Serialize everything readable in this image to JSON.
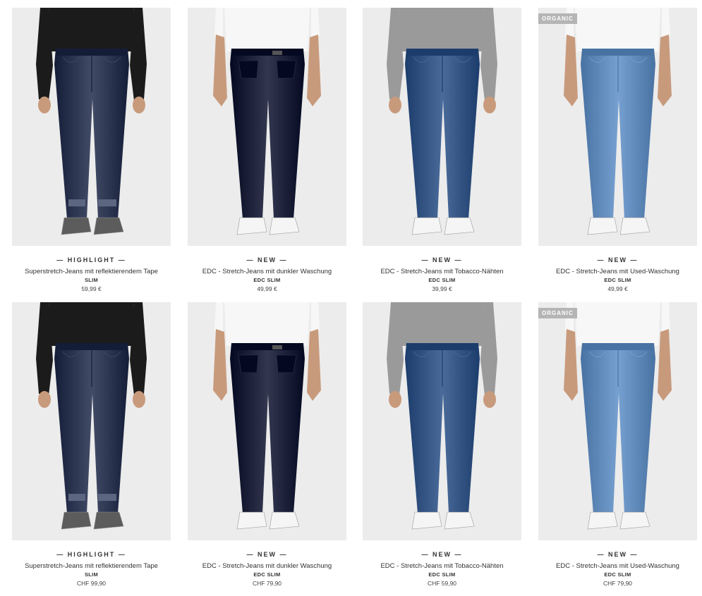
{
  "rows": [
    {
      "products": [
        {
          "label": "— HIGHLIGHT —",
          "title": "Superstretch-Jeans mit reflektierendem Tape",
          "brand": "SLIM",
          "price": "59,99 €",
          "badge": "",
          "jeans_color": "#262f4a",
          "wash": "raw",
          "top": "black-longsleeve",
          "shoes": "grey-sneakers",
          "image": "jeans-model-front-raw"
        },
        {
          "label": "— NEW —",
          "title": "EDC - Stretch-Jeans mit dunkler Waschung",
          "brand": "EDC SLIM",
          "price": "49,99 €",
          "badge": "",
          "jeans_color": "#161b33",
          "wash": "rinse",
          "top": "white-tshirt",
          "shoes": "white-sneakers",
          "image": "jeans-model-back-dark"
        },
        {
          "label": "— NEW —",
          "title": "EDC - Stretch-Jeans mit Tobacco-Nähten",
          "brand": "EDC SLIM",
          "price": "39,99 €",
          "badge": "",
          "jeans_color": "#2e4f7e",
          "wash": "medium",
          "top": "grey-longsleeve",
          "shoes": "white-sneakers",
          "image": "jeans-model-front-medium"
        },
        {
          "label": "— NEW —",
          "title": "EDC - Stretch-Jeans mit Used-Waschung",
          "brand": "EDC SLIM",
          "price": "49,99 €",
          "badge": "ORGANIC",
          "jeans_color": "#5a84b4",
          "wash": "used",
          "top": "white-tshirt",
          "shoes": "white-sneakers",
          "image": "jeans-model-front-used"
        }
      ]
    },
    {
      "products": [
        {
          "label": "— HIGHLIGHT —",
          "title": "Superstretch-Jeans mit reflektierendem Tape",
          "brand": "SLIM",
          "price": "CHF 99,90",
          "badge": "",
          "jeans_color": "#262f4a",
          "wash": "raw",
          "top": "black-longsleeve",
          "shoes": "grey-sneakers",
          "image": "jeans-model-front-raw"
        },
        {
          "label": "— NEW —",
          "title": "EDC - Stretch-Jeans mit dunkler Waschung",
          "brand": "EDC SLIM",
          "price": "CHF 79,90",
          "badge": "",
          "jeans_color": "#161b33",
          "wash": "rinse",
          "top": "white-tshirt",
          "shoes": "white-sneakers",
          "image": "jeans-model-back-dark"
        },
        {
          "label": "— NEW —",
          "title": "EDC - Stretch-Jeans mit Tobacco-Nähten",
          "brand": "EDC SLIM",
          "price": "CHF 59,90",
          "badge": "",
          "jeans_color": "#2e4f7e",
          "wash": "medium",
          "top": "grey-longsleeve",
          "shoes": "white-sneakers",
          "image": "jeans-model-front-medium"
        },
        {
          "label": "— NEW —",
          "title": "EDC - Stretch-Jeans mit Used-Waschung",
          "brand": "EDC SLIM",
          "price": "CHF 79,90",
          "badge": "ORGANIC",
          "jeans_color": "#5a84b4",
          "wash": "used",
          "top": "white-tshirt",
          "shoes": "white-sneakers",
          "image": "jeans-model-front-used"
        }
      ]
    }
  ],
  "colors": {
    "photo_bg": "#ececec",
    "badge_bg": "#b5b5b5",
    "text": "#333333",
    "skin": "#c89a7c",
    "black_top": "#1b1b1b",
    "grey_top": "#9a9a9a",
    "white_top": "#f7f7f7",
    "grey_shoe": "#5c5c5c",
    "white_shoe": "#f5f5f5"
  }
}
